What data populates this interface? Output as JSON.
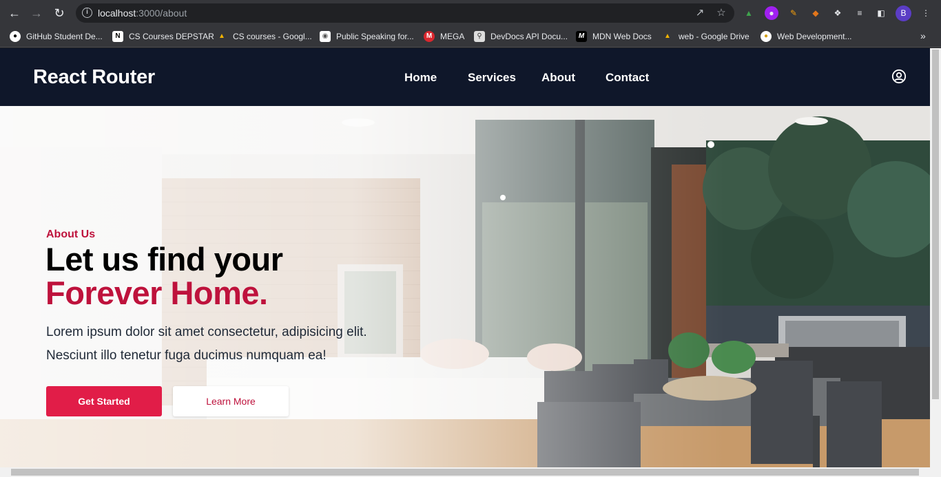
{
  "browser": {
    "url_host": "localhost",
    "url_path": ":3000/about",
    "avatar_letter": "B",
    "bookmarks": [
      {
        "label": "GitHub Student De...",
        "icon": "github-icon",
        "color": "#ffffff"
      },
      {
        "label": "CS Courses DEPSTAR",
        "icon": "notion-icon",
        "color": "#ffffff"
      },
      {
        "label": "CS courses - Googl...",
        "icon": "google-drive-icon",
        "color": "#f4b400"
      },
      {
        "label": "Public Speaking for...",
        "icon": "map-pin-icon",
        "color": "#ffffff"
      },
      {
        "label": "MEGA",
        "icon": "mega-icon",
        "color": "#d9272e"
      },
      {
        "label": "DevDocs API Docu...",
        "icon": "devdocs-icon",
        "color": "#dddddd"
      },
      {
        "label": "MDN Web Docs",
        "icon": "mdn-icon",
        "color": "#000000"
      },
      {
        "label": "web - Google Drive",
        "icon": "google-drive-icon",
        "color": "#f4b400"
      },
      {
        "label": "Web Development...",
        "icon": "bulb-icon",
        "color": "#ffffff"
      }
    ]
  },
  "site": {
    "brand": "React Router",
    "menu": [
      "Home",
      "Services",
      "About",
      "Contact"
    ],
    "accent_color": "#e11d48",
    "header_color": "#0f172a"
  },
  "hero": {
    "eyebrow": "About Us",
    "headline_line1": "Let us find your",
    "headline_line2": "Forever Home.",
    "description_line1": "Lorem ipsum dolor sit amet consectetur, adipisicing elit.",
    "description_line2": "Nesciunt illo tenetur fuga ducimus numquam ea!",
    "primary_button": "Get Started",
    "secondary_button": "Learn More"
  }
}
